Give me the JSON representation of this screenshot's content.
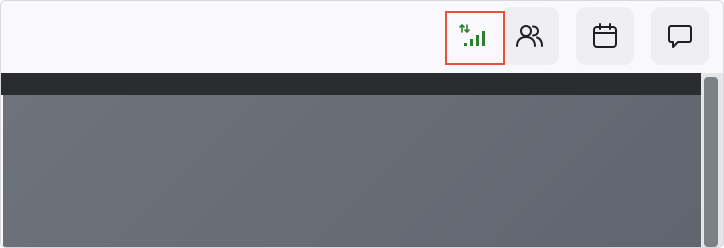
{
  "toolbar": {
    "buttons": [
      {
        "name": "network-status",
        "icon": "signal-bars-icon",
        "icon_color": "#2f7d32",
        "highlight_color": "#e5533d"
      },
      {
        "name": "people",
        "icon": "people-icon"
      },
      {
        "name": "calendar",
        "icon": "calendar-icon"
      },
      {
        "name": "chat",
        "icon": "chat-bubble-icon"
      }
    ]
  },
  "colors": {
    "toolbar_bg": "#f9f9fb",
    "button_bg": "#efeff2",
    "dark_strip": "#2b2c2e",
    "content_bg": "#6a7078",
    "icon": "#1f1f24"
  }
}
